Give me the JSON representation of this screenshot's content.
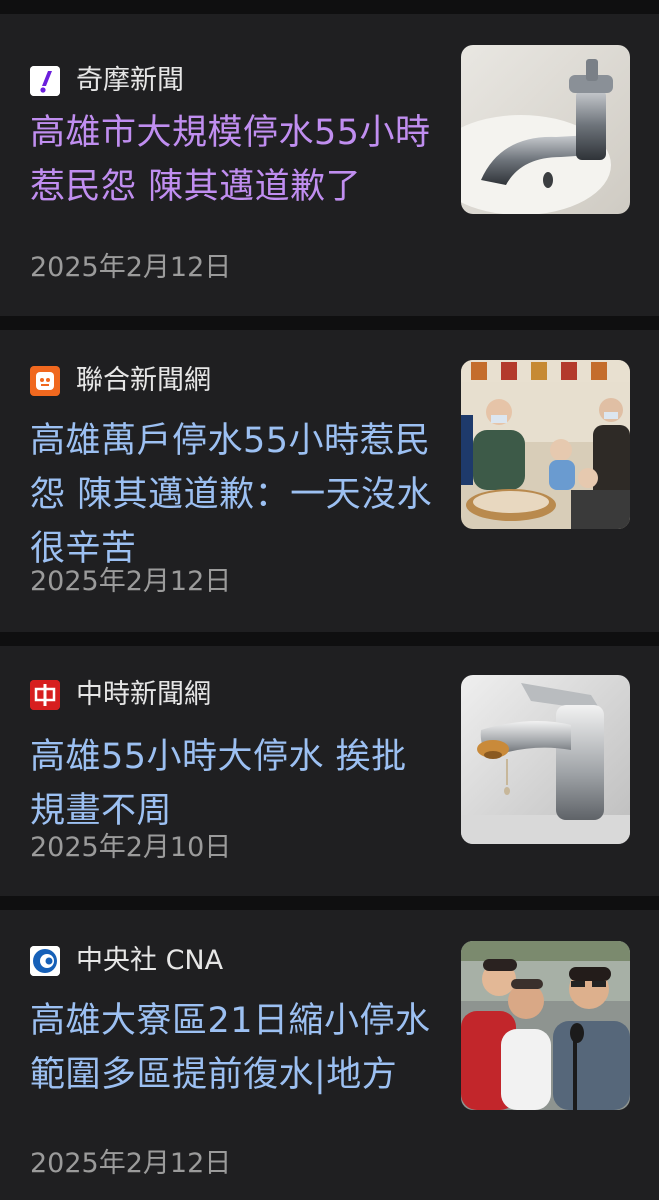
{
  "articles": [
    {
      "source": "奇摩新聞",
      "source_icon": "yahoo-icon",
      "headline": "高雄市大規模停水55小時惹民怨 陳其邁道歉了",
      "date": "2025年2月12日",
      "visited": true,
      "thumbnail": "faucet-photo"
    },
    {
      "source": "聯合新聞網",
      "source_icon": "udn-icon",
      "headline": "高雄萬戶停水55小時惹民怨 陳其邁道歉：一天沒水很辛苦",
      "date": "2025年2月12日",
      "visited": false,
      "thumbnail": "mayor-with-children-photo"
    },
    {
      "source": "中時新聞網",
      "source_icon": "chinatimes-icon",
      "headline": "高雄55小時大停水 挨批規畫不周",
      "date": "2025年2月10日",
      "visited": false,
      "thumbnail": "dripping-faucet-photo"
    },
    {
      "source": "中央社 CNA",
      "source_icon": "cna-icon",
      "headline": "高雄大寮區21日縮小停水範圍多區提前復水|地方",
      "date": "2025年2月12日",
      "visited": false,
      "thumbnail": "press-conference-photo"
    }
  ],
  "colors": {
    "background": "#0f0f10",
    "card": "#1f1f21",
    "headline_visited": "#c08ef0",
    "headline_unvisited": "#9cc0f2",
    "date": "#9b9b9b"
  }
}
